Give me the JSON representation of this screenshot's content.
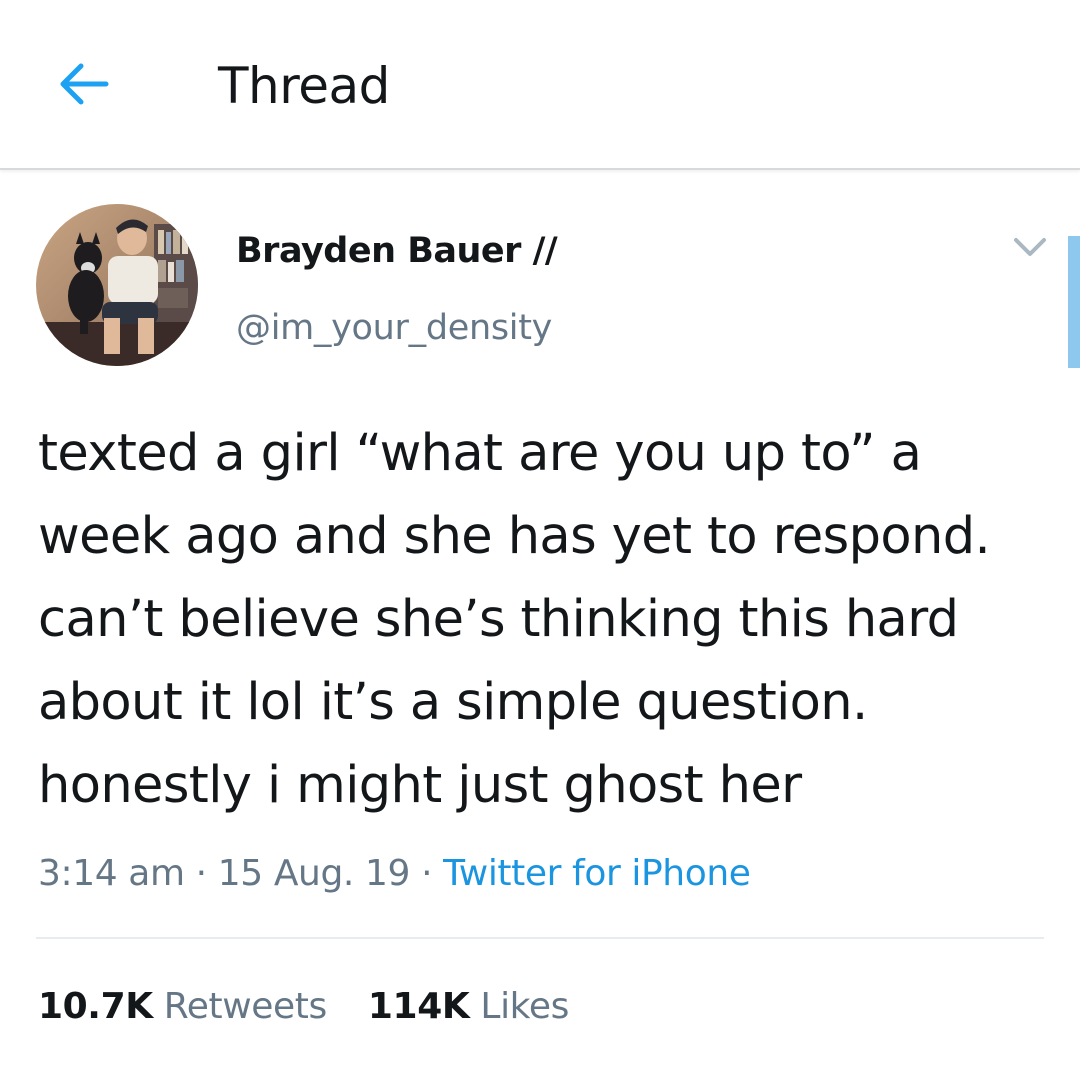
{
  "header": {
    "title": "Thread",
    "back_icon": "arrow-left-icon"
  },
  "colors": {
    "accent": "#1da1f2",
    "link": "#1b95e0",
    "text_primary": "#14171a",
    "text_secondary": "#657786"
  },
  "tweet": {
    "author": {
      "display_name": "Brayden Bauer //",
      "handle": "@im_your_density"
    },
    "text": "texted a girl “what are you up to” a week ago and she has yet to respond. can’t believe she’s thinking this hard about it lol it’s a simple question. honestly i might just ghost her",
    "time": "3:14 am",
    "date": "15 Aug. 19",
    "separator": "·",
    "source": "Twitter for iPhone",
    "retweets": {
      "count": "10.7K",
      "label": "Retweets"
    },
    "likes": {
      "count": "114K",
      "label": "Likes"
    },
    "menu_icon": "chevron-down-icon"
  }
}
